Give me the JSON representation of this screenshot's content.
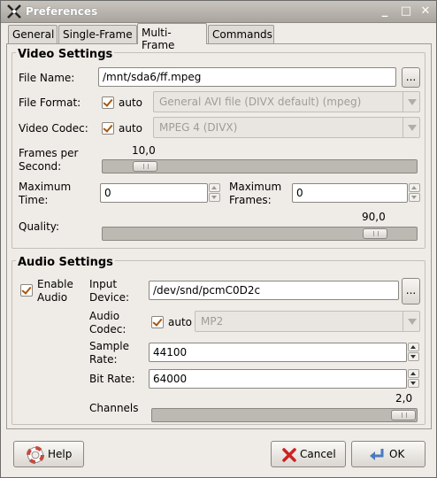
{
  "window": {
    "title": "Preferences"
  },
  "tabs": [
    {
      "label": "General",
      "active": false
    },
    {
      "label": "Single-Frame",
      "active": false
    },
    {
      "label": "Multi-Frame",
      "active": true
    },
    {
      "label": "Commands",
      "active": false
    }
  ],
  "video": {
    "section_title": "Video Settings",
    "file_name_label": "File Name:",
    "file_name_value": "/mnt/sda6/ff.mpeg",
    "browse_label": "...",
    "file_format_label": "File Format:",
    "file_format_auto_label": "auto",
    "file_format_auto_checked": true,
    "file_format_value": "General AVI file (DIVX default) (mpeg)",
    "video_codec_label": "Video Codec:",
    "video_codec_auto_label": "auto",
    "video_codec_auto_checked": true,
    "video_codec_value": "MPEG 4 (DIVX)",
    "fps_label_1": "Frames per",
    "fps_label_2": "Second:",
    "fps_value_text": "10,0",
    "max_time_label_1": "Maximum",
    "max_time_label_2": "Time:",
    "max_time_value": "0",
    "max_frames_label_1": "Maximum",
    "max_frames_label_2": "Frames:",
    "max_frames_value": "0",
    "quality_label": "Quality:",
    "quality_value_text": "90,0"
  },
  "audio": {
    "section_title": "Audio Settings",
    "enable_label_1": "Enable",
    "enable_label_2": "Audio",
    "enable_checked": true,
    "input_device_label_1": "Input",
    "input_device_label_2": "Device:",
    "input_device_value": "/dev/snd/pcmC0D2c",
    "browse_label": "...",
    "codec_label_1": "Audio",
    "codec_label_2": "Codec:",
    "codec_auto_label": "auto",
    "codec_auto_checked": true,
    "codec_value": "MP2",
    "sample_rate_label_1": "Sample",
    "sample_rate_label_2": "Rate:",
    "sample_rate_value": "44100",
    "bit_rate_label": "Bit Rate:",
    "bit_rate_value": "64000",
    "channels_label": "Channels",
    "channels_value_text": "2,0"
  },
  "buttons": {
    "help": "Help",
    "cancel": "Cancel",
    "ok": "OK"
  },
  "icons": {
    "app": "app-icon",
    "help": "lifebuoy-icon",
    "cancel": "red-x-icon",
    "ok": "return-arrow-icon"
  },
  "colors": {
    "background": "#efebe7",
    "checkmark": "#a8570d",
    "cancel_icon": "#cc2222",
    "help_icon": "#d93a2b"
  }
}
